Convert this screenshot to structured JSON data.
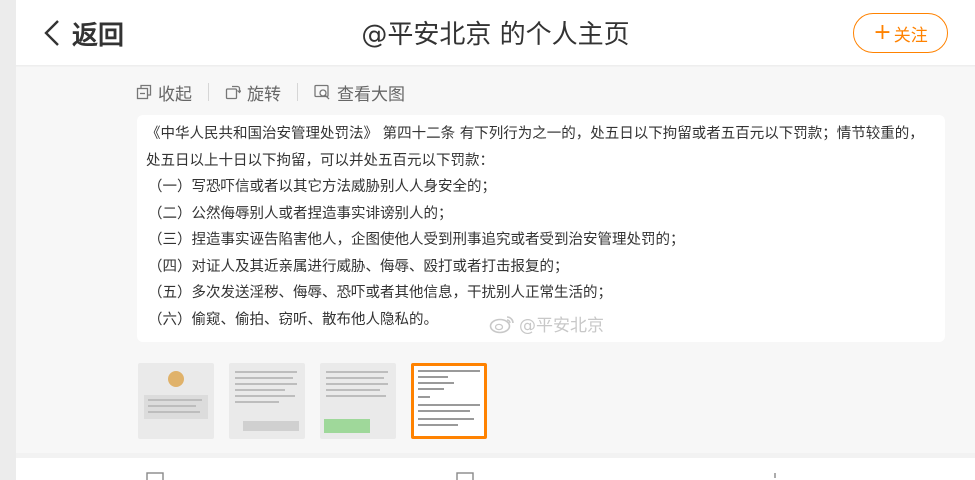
{
  "header": {
    "back_label": "返回",
    "title": "@平安北京 的个人主页",
    "follow_label": "关注",
    "follow_plus": "+"
  },
  "toolbar": {
    "collapse_label": "收起",
    "rotate_label": "旋转",
    "view_large_label": "查看大图"
  },
  "post_image": {
    "lines": [
      "《中华人民共和国治安管理处罚法》 第四十二条 有下列行为之一的，处五日以下拘留或者五百元以下罚款；情节较重的，",
      "处五日以上十日以下拘留，可以并处五百元以下罚款：",
      "（一）写恐吓信或者以其它方法威胁别人人身安全的；",
      "（二）公然侮辱别人或者捏造事实诽谤别人的；",
      "（三）捏造事实诬告陷害他人，企图使他人受到刑事追究或者受到治安管理处罚的；",
      "（四）对证人及其近亲属进行威胁、侮辱、殴打或者打击报复的；",
      "（五）多次发送淫秽、侮辱、恐吓或者其他信息，干扰别人正常生活的；",
      "（六）偷窥、偷拍、窃听、散布他人隐私的。"
    ],
    "watermark": "@平安北京"
  },
  "thumbnails": {
    "count": 4,
    "active_index": 3
  },
  "colors": {
    "accent": "#ff8200"
  }
}
